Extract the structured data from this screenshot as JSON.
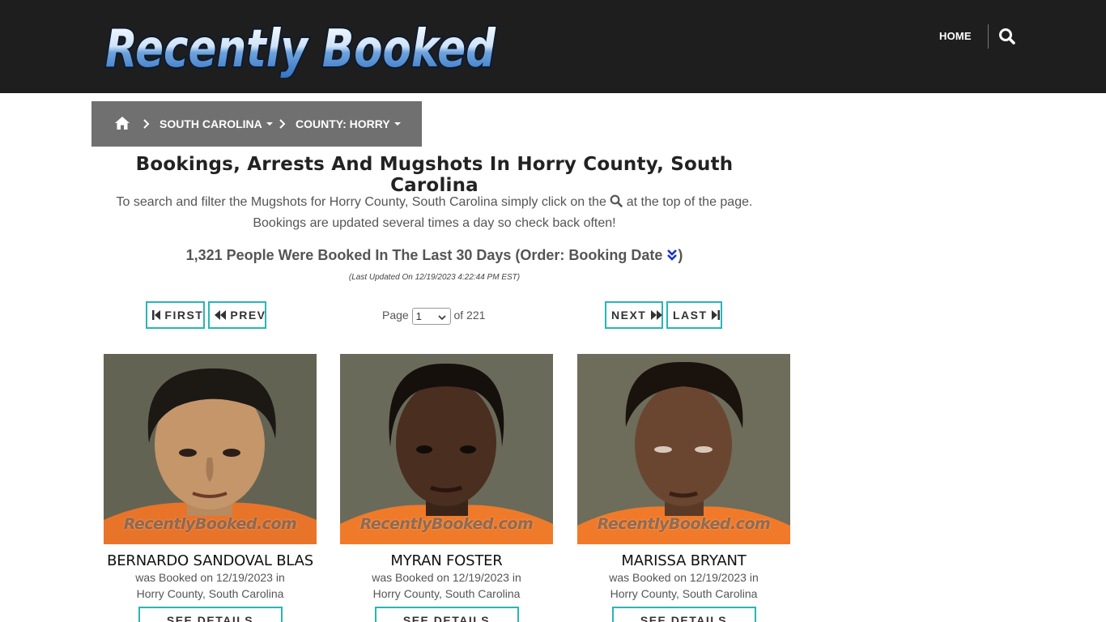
{
  "header": {
    "logo_text": "Recently Booked",
    "nav_home": "HOME"
  },
  "breadcrumb": {
    "state": "SOUTH CAROLINA",
    "county": "COUNTY: HORRY"
  },
  "page": {
    "title": "Bookings, Arrests And Mugshots In Horry County, South Carolina",
    "intro_before_icon": "To search and filter the Mugshots for Horry County, South Carolina simply click on the",
    "intro_after_icon": "at the top of the page.",
    "intro_line2": "Bookings are updated several times a day so check back often!",
    "count_text": "1,321 People Were Booked In The Last 30 Days (Order: Booking Date",
    "count_close": ")",
    "last_updated": "(Last Updated On 12/19/2023 4:22:44 PM EST)"
  },
  "pager": {
    "first": "FIRST",
    "prev": "PREV",
    "next": "NEXT",
    "last": "LAST",
    "page_label": "Page",
    "current_page": "1",
    "of_label": "of 221"
  },
  "watermark_text": "RecentlyBooked.com",
  "bookings": [
    {
      "name": "BERNARDO SANDOVAL BLAS",
      "booked_line": "was Booked on 12/19/2023 in",
      "location": "Horry County, South Carolina",
      "button": "SEE DETAILS"
    },
    {
      "name": "MYRAN FOSTER",
      "booked_line": "was Booked on 12/19/2023 in",
      "location": "Horry County, South Carolina",
      "button": "SEE DETAILS"
    },
    {
      "name": "MARISSA BRYANT",
      "booked_line": "was Booked on 12/19/2023 in",
      "location": "Horry County, South Carolina",
      "button": "SEE DETAILS"
    }
  ],
  "colors": {
    "header_bg": "#1e1e1e",
    "breadcrumb_bg": "#707070",
    "button_border": "#2ab5b5",
    "jumpsuit": "#f07a2a",
    "order_icon": "#1a33cc"
  }
}
